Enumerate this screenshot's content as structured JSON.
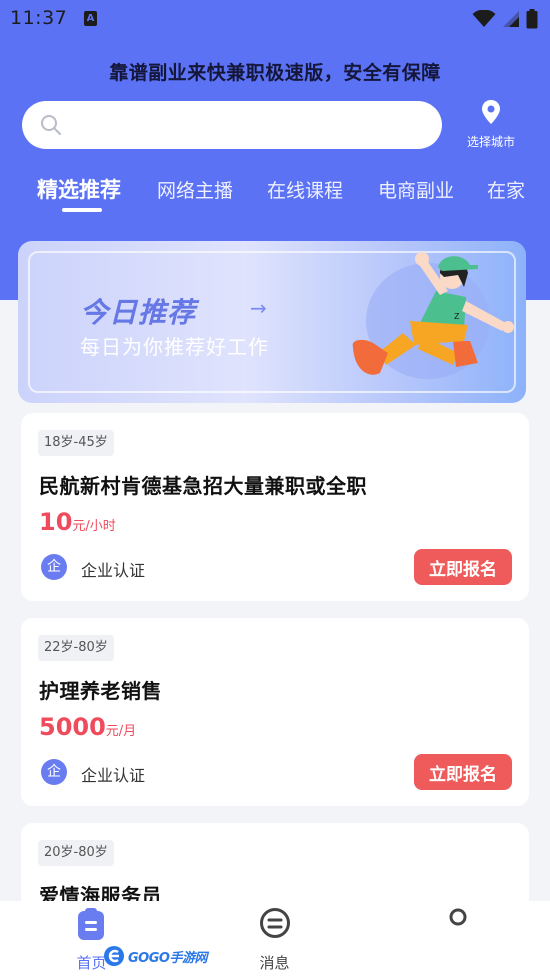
{
  "status_bar": {
    "time": "11:37",
    "notification_badge": "A"
  },
  "tagline": "靠谱副业来快兼职极速版，安全有保障",
  "search": {
    "placeholder": ""
  },
  "city": {
    "label": "选择城市",
    "icon": "location-pin-icon"
  },
  "tabs": [
    {
      "label": "精选推荐",
      "active": true
    },
    {
      "label": "网络主播",
      "active": false
    },
    {
      "label": "在线课程",
      "active": false
    },
    {
      "label": "电商副业",
      "active": false
    },
    {
      "label": "在家",
      "active": false
    }
  ],
  "banner": {
    "title": "今日推荐",
    "arrow": "→",
    "subtitle": "每日为你推荐好工作"
  },
  "jobs": [
    {
      "age": "18岁-45岁",
      "title": "民航新村肯德基急招大量兼职或全职",
      "salary": "10",
      "unit": "元/小时",
      "cert_badge": "企",
      "cert": "企业认证",
      "apply": "立即报名"
    },
    {
      "age": "22岁-80岁",
      "title": "护理养老销售",
      "salary": "5000",
      "unit": "元/月",
      "cert_badge": "企",
      "cert": "企业认证",
      "apply": "立即报名"
    },
    {
      "age": "20岁-80岁",
      "title": "爱情海服务员",
      "salary": "",
      "unit": "",
      "cert_badge": "",
      "cert": "",
      "apply": ""
    }
  ],
  "bottom_nav": [
    {
      "label": "首页",
      "icon": "home-doc-icon",
      "active": true
    },
    {
      "label": "消息",
      "icon": "message-icon",
      "active": false
    },
    {
      "label": "",
      "icon": "profile-icon",
      "active": false
    }
  ],
  "watermark": {
    "text": "GOGO手游网"
  },
  "colors": {
    "primary": "#5b72f4",
    "accent_red": "#ef4b5c",
    "button_red": "#ef5a5a",
    "background": "#f3f4f8"
  }
}
